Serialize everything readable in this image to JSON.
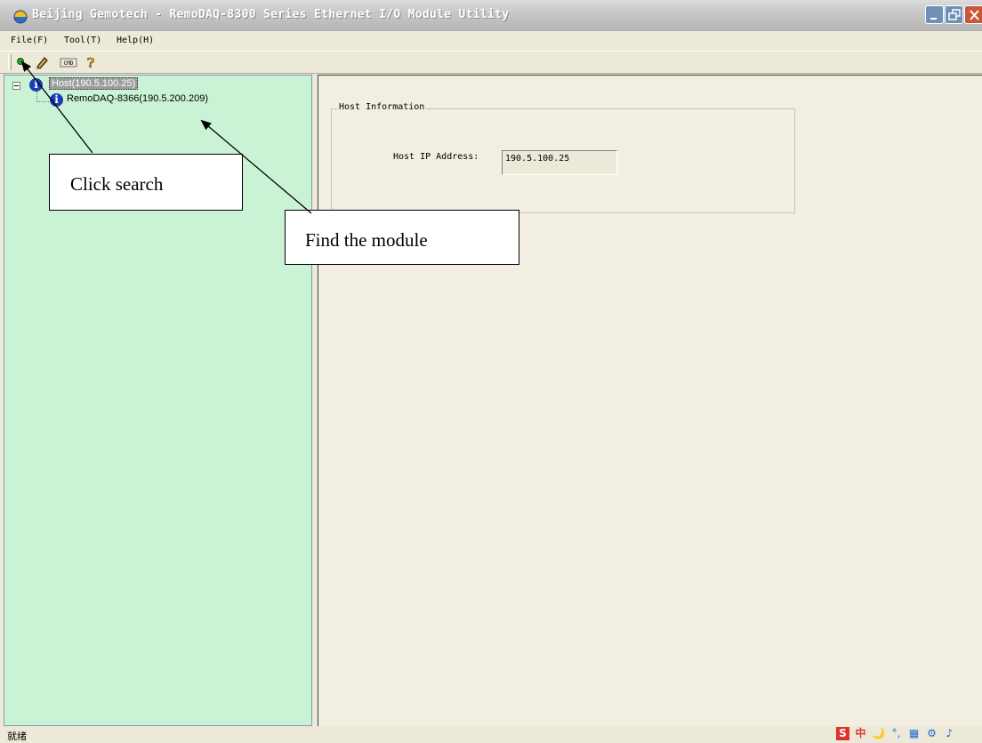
{
  "window": {
    "title": "Beijing Gemotech - RemoDAQ-8300 Series Ethernet I/O Module Utility",
    "controls": [
      "minimize-icon",
      "restore-icon",
      "close-icon"
    ]
  },
  "menu": {
    "items": [
      {
        "label": "File(F)"
      },
      {
        "label": "Tool(T)"
      },
      {
        "label": "Help(H)"
      }
    ]
  },
  "toolbar": {
    "buttons": [
      {
        "icon": "search-icon"
      },
      {
        "icon": "pencil-icon"
      },
      {
        "icon": "cmd-icon",
        "label": "CMD"
      },
      {
        "icon": "help-icon",
        "label": "?"
      }
    ]
  },
  "tree": {
    "host": {
      "label": "Host(190.5.100.25)",
      "icon": "info-icon",
      "info_glyph": "i"
    },
    "module": {
      "label": "RemoDAQ-8366(190.5.200.209)",
      "icon": "info-icon",
      "info_glyph": "i"
    }
  },
  "host_info": {
    "group_title": "Host Information",
    "ip_label": "Host IP Address:",
    "ip_value": "190.5.100.25"
  },
  "annotations": {
    "search_callout": "Click search",
    "find_callout": "Find the module"
  },
  "status": {
    "text": "就绪",
    "ime_icons": [
      "S",
      "中",
      "🌙",
      "°,",
      "▦",
      "⚙",
      "♪"
    ]
  },
  "colors": {
    "tree_background": "#c9f3d4",
    "content_background": "#f2eee2",
    "chrome": "#ece9d8",
    "info_icon": "#1a3fb5",
    "ime_red": "#e0322b"
  }
}
